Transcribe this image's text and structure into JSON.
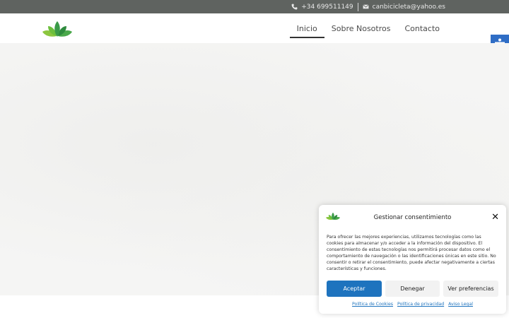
{
  "topbar": {
    "phone": "+34 699511149",
    "email": "canbicicleta@yahoo.es",
    "phone_icon": "phone-icon",
    "email_icon": "envelope-icon"
  },
  "nav": {
    "items": [
      {
        "label": "Inicio",
        "active": true
      },
      {
        "label": "Sobre Nosotros",
        "active": false
      },
      {
        "label": "Contacto",
        "active": false
      }
    ]
  },
  "accessibility": {
    "icon": "accessibility-icon",
    "color": "#2f6dc5"
  },
  "consent": {
    "title": "Gestionar consentimiento",
    "close_icon": "close-icon",
    "text": "Para ofrecer las mejores experiencias, utilizamos tecnologías como las cookies para almacenar y/o acceder a la información del dispositivo. El consentimiento de estas tecnologías nos permitirá procesar datos como el comportamiento de navegación o las identificaciones únicas en este sitio. No consentir o retirar el consentimiento, puede afectar negativamente a ciertas características y funciones.",
    "accept": "Aceptar",
    "deny": "Denegar",
    "preferences": "Ver preferencias",
    "links": [
      "Política de Cookies",
      "Política de privacidad",
      "Aviso Legal"
    ],
    "accent": "#1e73be"
  }
}
